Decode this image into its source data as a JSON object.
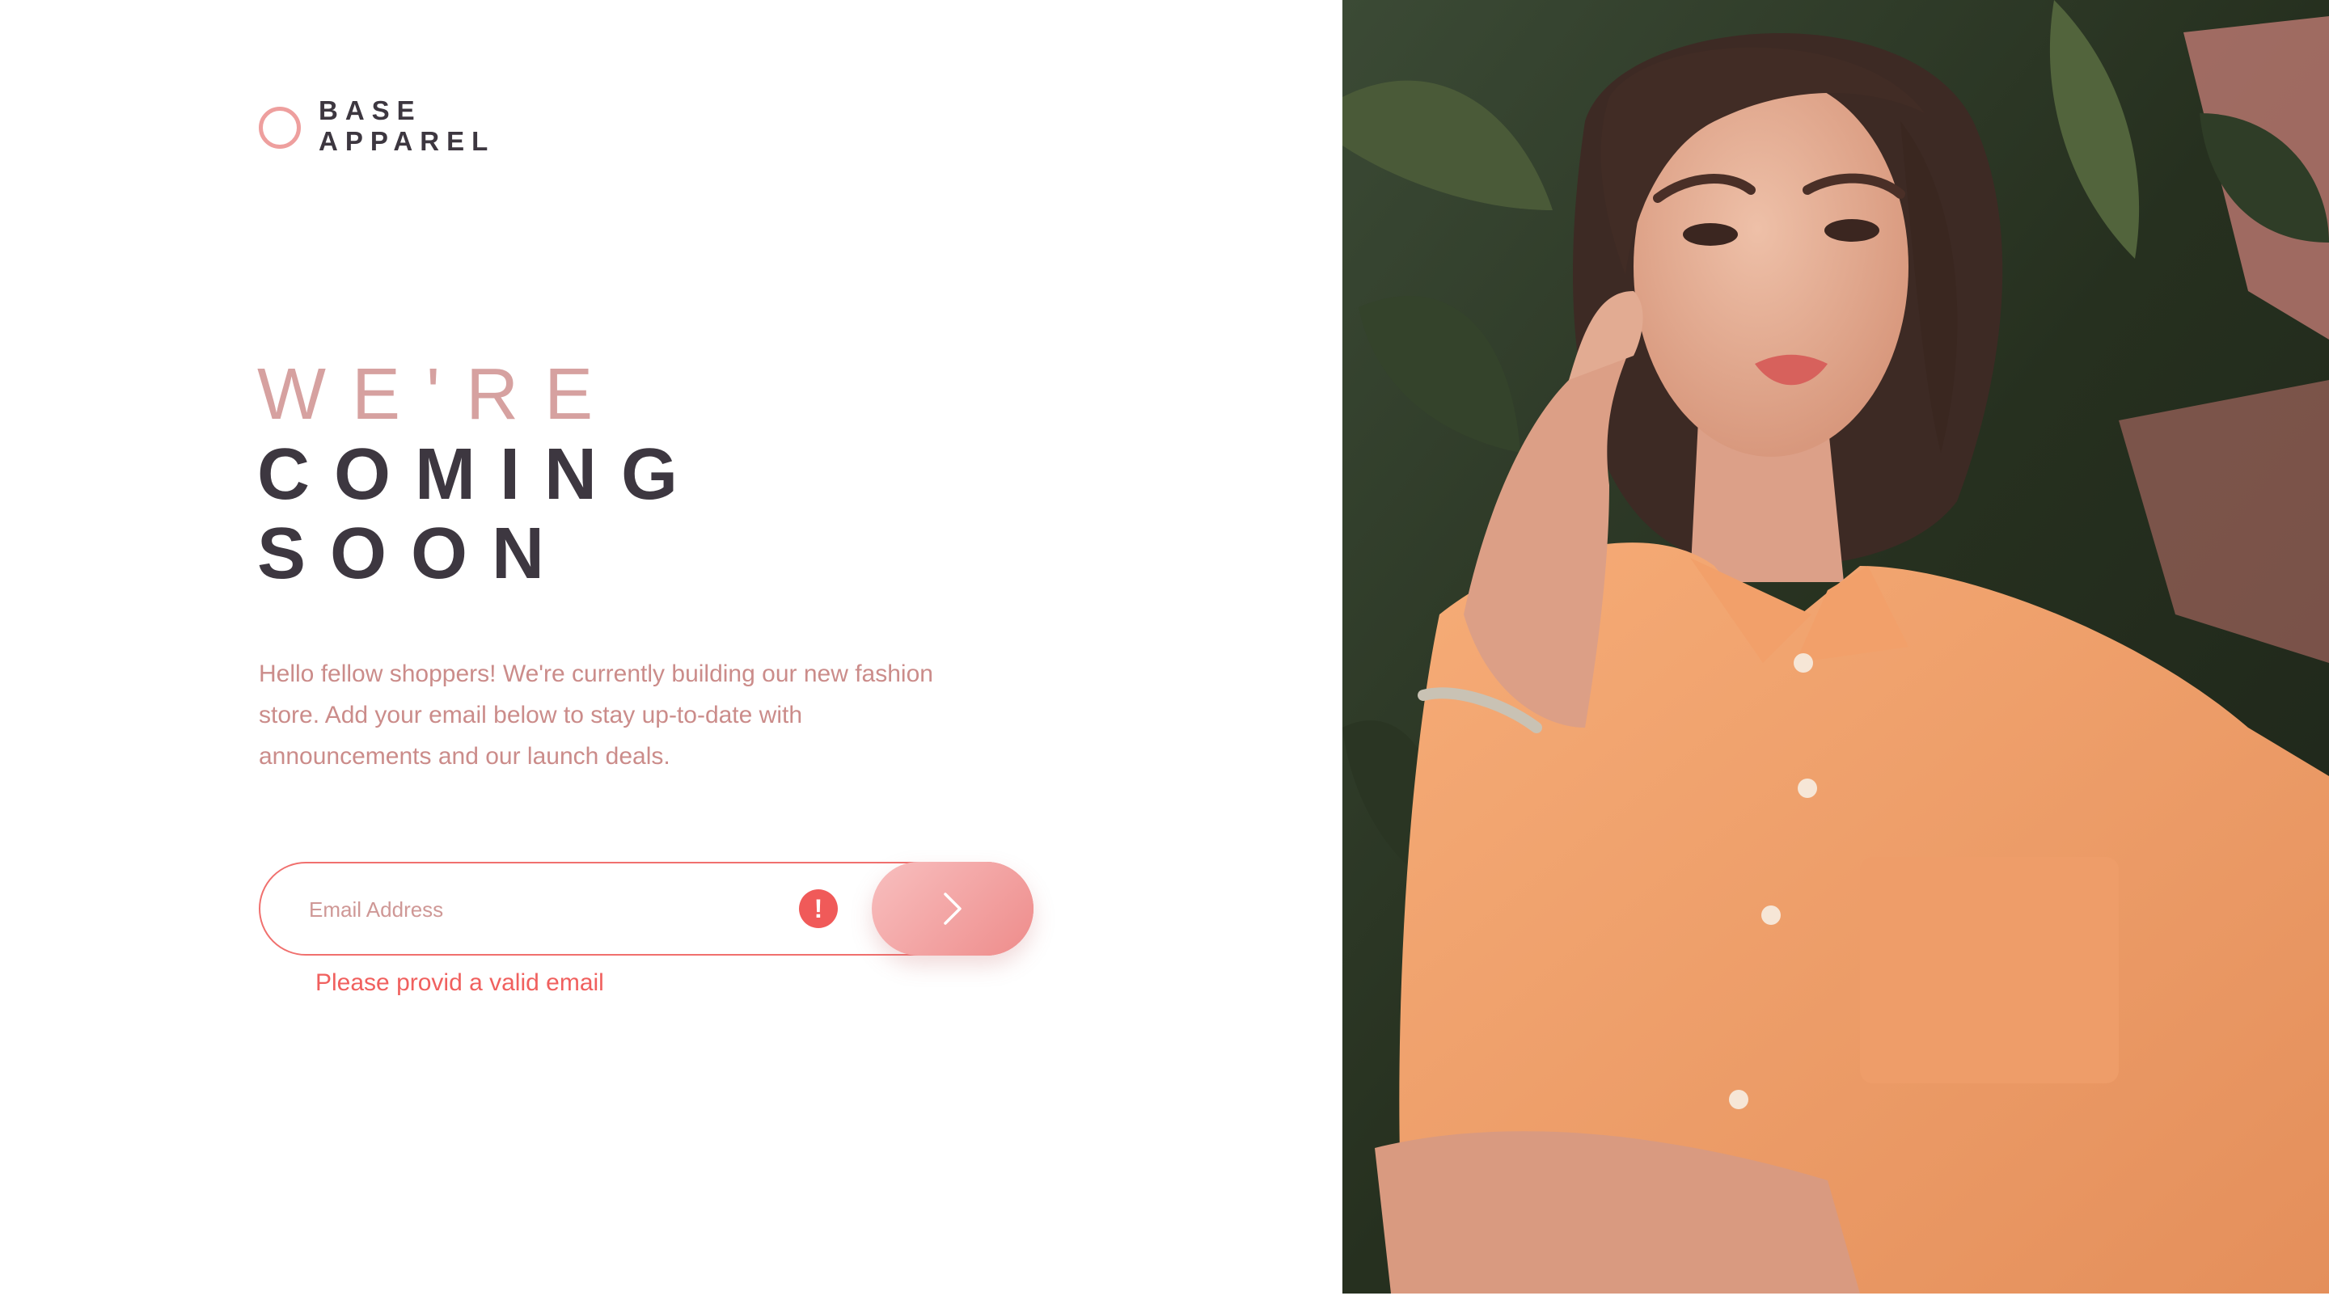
{
  "brand": {
    "line1": "BASE",
    "line2": "APPAREL"
  },
  "heading": {
    "line1": "WE'RE",
    "line2": "COMING",
    "line3": "SOON"
  },
  "description": "Hello fellow shoppers! We're currently building our new fashion store. Add your email below to stay up-to-date with announcements and our launch deals.",
  "form": {
    "email_placeholder": "Email Address",
    "email_value": "",
    "error_icon": "!",
    "submit_icon": "chevron-right-icon",
    "error_message": "Please provid a valid email"
  },
  "colors": {
    "accent": "#ee9f9e",
    "dark_text": "#3d3740",
    "desaturated_red": "#cb8c8a",
    "error": "#f05a59"
  },
  "hero_image": {
    "subject": "woman-in-orange-shirt-photo"
  }
}
